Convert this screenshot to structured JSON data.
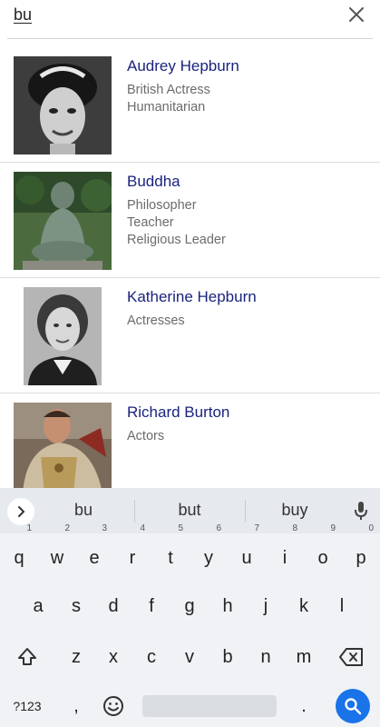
{
  "search": {
    "query": "bu"
  },
  "results": [
    {
      "name": "Audrey Hepburn",
      "lines": [
        "British Actress",
        "Humanitarian"
      ]
    },
    {
      "name": "Buddha",
      "lines": [
        "Philosopher",
        "Teacher",
        "Religious Leader"
      ]
    },
    {
      "name": "Katherine Hepburn",
      "lines": [
        "Actresses"
      ]
    },
    {
      "name": "Richard Burton",
      "lines": [
        "Actors"
      ]
    }
  ],
  "keyboard": {
    "suggestions": [
      "bu",
      "but",
      "buy"
    ],
    "row1": [
      {
        "k": "q",
        "n": "1"
      },
      {
        "k": "w",
        "n": "2"
      },
      {
        "k": "e",
        "n": "3"
      },
      {
        "k": "r",
        "n": "4"
      },
      {
        "k": "t",
        "n": "5"
      },
      {
        "k": "y",
        "n": "6"
      },
      {
        "k": "u",
        "n": "7"
      },
      {
        "k": "i",
        "n": "8"
      },
      {
        "k": "o",
        "n": "9"
      },
      {
        "k": "p",
        "n": "0"
      }
    ],
    "row2": [
      "a",
      "s",
      "d",
      "f",
      "g",
      "h",
      "j",
      "k",
      "l"
    ],
    "row3": [
      "z",
      "x",
      "c",
      "v",
      "b",
      "n",
      "m"
    ],
    "symbols_label": "?123",
    "comma": ",",
    "period": "."
  },
  "colors": {
    "name": "#1a237e",
    "desc": "#6b6b6b",
    "search_key": "#1a73e8"
  },
  "icons": [
    "close-icon",
    "chevron-right-icon",
    "mic-icon",
    "shift-icon",
    "backspace-icon",
    "emoji-icon",
    "search-icon"
  ]
}
